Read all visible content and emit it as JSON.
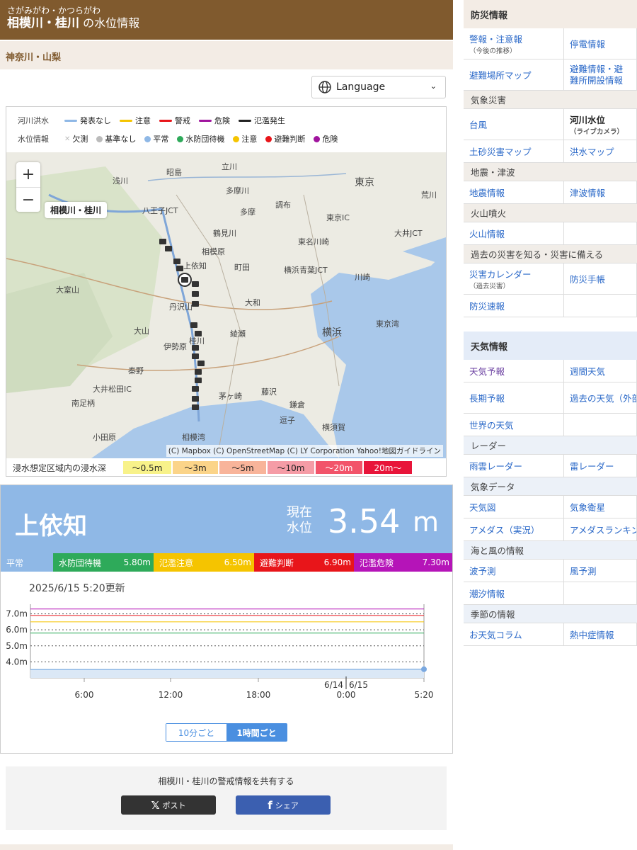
{
  "header": {
    "ruby": "さがみがわ・かつらがわ",
    "river": "相模川・桂川",
    "suffix": "の水位情報"
  },
  "region": "神奈川・山梨",
  "language": "Language",
  "legend": {
    "flood_label": "河川洪水",
    "flood_items": [
      {
        "label": "発表なし",
        "color": "#8fb8e6"
      },
      {
        "label": "注意",
        "color": "#f5c400"
      },
      {
        "label": "警戒",
        "color": "#e8151a"
      },
      {
        "label": "危険",
        "color": "#a0149e"
      },
      {
        "label": "氾濫発生",
        "color": "#222222"
      }
    ],
    "level_label": "水位情報",
    "level_items": [
      {
        "label": "欠測",
        "color": "#bbbbbb",
        "icon": "x-mark-icon"
      },
      {
        "label": "基準なし",
        "color": "#bbbbbb"
      },
      {
        "label": "平常",
        "color": "#8fb8e6"
      },
      {
        "label": "水防団待機",
        "color": "#2eaa5a"
      },
      {
        "label": "注意",
        "color": "#f5c400"
      },
      {
        "label": "避難判断",
        "color": "#e8151a"
      },
      {
        "label": "危険",
        "color": "#a0149e"
      }
    ]
  },
  "map": {
    "river_tag": "相模川・桂川",
    "attribution": "(C) Mapbox (C) OpenStreetMap (C) LY Corporation Yahoo!地図ガイドライン",
    "labels": [
      "浅川",
      "多摩川",
      "鶴見川",
      "東京",
      "荒川",
      "八王子JCT",
      "相模原",
      "町田",
      "東京IC",
      "東名川崎",
      "横浜青葉JCT",
      "大井JCT",
      "川崎",
      "大和",
      "横浜",
      "東京湾",
      "綾瀬",
      "伊勢原",
      "秦野",
      "大井松田IC",
      "南足柄",
      "小田原",
      "茅ヶ崎",
      "藤沢",
      "鎌倉",
      "逗子",
      "横須賀",
      "相模湾",
      "立川",
      "昭島",
      "調布",
      "多摩",
      "丹沢山",
      "大室山",
      "大山",
      "桂川",
      "上依知"
    ]
  },
  "depth": {
    "label": "浸水想定区域内の浸水深",
    "bins": [
      {
        "label": "〜0.5m",
        "color": "#f8f28a"
      },
      {
        "label": "〜3m",
        "color": "#fbd489"
      },
      {
        "label": "〜5m",
        "color": "#f8b49a"
      },
      {
        "label": "〜10m",
        "color": "#f59ca6"
      },
      {
        "label": "〜20m",
        "color": "#f2546a"
      },
      {
        "label": "20m〜",
        "color": "#e8153a"
      }
    ]
  },
  "station": {
    "name": "上依知",
    "current_label_1": "現在",
    "current_label_2": "水位",
    "value": "3.54",
    "unit": "m"
  },
  "thresholds": [
    {
      "label": "平常",
      "value": "",
      "color": "#8fb8e6"
    },
    {
      "label": "水防団待機",
      "value": "5.80m",
      "color": "#2eaa5a"
    },
    {
      "label": "氾濫注意",
      "value": "6.50m",
      "color": "#f5c400"
    },
    {
      "label": "避難判断",
      "value": "6.90m",
      "color": "#e8151a"
    },
    {
      "label": "氾濫危険",
      "value": "7.30m",
      "color": "#b514b8"
    }
  ],
  "updated": "2025/6/15 5:20更新",
  "chart_data": {
    "type": "line",
    "title": "",
    "xlabel": "",
    "ylabel": "",
    "x_ticks": [
      "6:00",
      "12:00",
      "18:00",
      "6/14 | 6/15 0:00",
      "5:20"
    ],
    "y_ticks": [
      "4.0m",
      "5.0m",
      "6.0m",
      "7.0m"
    ],
    "ylim": [
      3.0,
      7.6
    ],
    "threshold_lines": [
      {
        "name": "水防団待機",
        "value": 5.8,
        "color": "#2eaa5a"
      },
      {
        "name": "氾濫注意",
        "value": 6.5,
        "color": "#f5c400"
      },
      {
        "name": "避難判断",
        "value": 6.9,
        "color": "#e8151a"
      },
      {
        "name": "氾濫危険",
        "value": 7.3,
        "color": "#b514b8"
      }
    ],
    "series": [
      {
        "values_x": [
          0,
          0.25,
          0.5,
          0.75,
          1.0
        ],
        "values": [
          3.52,
          3.52,
          3.52,
          3.53,
          3.54
        ],
        "color": "#8fb8e6"
      }
    ]
  },
  "interval_tabs": [
    "10分ごと",
    "1時間ごと"
  ],
  "share": {
    "title": "相模川・桂川の警戒情報を共有する",
    "x_label": "ポスト",
    "fb_label": "シェア"
  },
  "sidebar": {
    "disaster_title": "防災情報",
    "disaster_rows": [
      {
        "type": "pair",
        "items": [
          {
            "label": "警報・注意報",
            "sub": "（今後の推移）"
          },
          {
            "label": "停電情報"
          }
        ]
      },
      {
        "type": "pair",
        "items": [
          {
            "label": "避難場所マップ"
          },
          {
            "label": "避難情報・避難所開設情報"
          }
        ]
      },
      {
        "type": "cat",
        "label": "気象災害"
      },
      {
        "type": "pair",
        "items": [
          {
            "label": "台風"
          },
          {
            "label": "河川水位",
            "sub": "（ライブカメラ）",
            "plain": true
          }
        ]
      },
      {
        "type": "pair",
        "items": [
          {
            "label": "土砂災害マップ"
          },
          {
            "label": "洪水マップ"
          }
        ]
      },
      {
        "type": "cat",
        "label": "地震・津波"
      },
      {
        "type": "pair",
        "items": [
          {
            "label": "地震情報"
          },
          {
            "label": "津波情報"
          }
        ]
      },
      {
        "type": "cat",
        "label": "火山噴火"
      },
      {
        "type": "pair",
        "items": [
          {
            "label": "火山情報"
          },
          {
            "label": ""
          }
        ]
      },
      {
        "type": "cat",
        "label": "過去の災害を知る・災害に備える"
      },
      {
        "type": "pair",
        "items": [
          {
            "label": "災害カレンダー",
            "sub": "（過去災害）"
          },
          {
            "label": "防災手帳"
          }
        ]
      },
      {
        "type": "pair",
        "items": [
          {
            "label": "防災速報"
          },
          {
            "label": ""
          }
        ]
      }
    ],
    "weather_title": "天気情報",
    "weather_rows": [
      {
        "type": "pair",
        "items": [
          {
            "label": "天気予報"
          },
          {
            "label": "週間天気"
          }
        ]
      },
      {
        "type": "pair",
        "items": [
          {
            "label": "長期予報"
          },
          {
            "label": "過去の天気（外部サイト）"
          }
        ]
      },
      {
        "type": "pair",
        "items": [
          {
            "label": "世界の天気"
          },
          {
            "label": ""
          }
        ]
      },
      {
        "type": "cat",
        "label": "レーダー"
      },
      {
        "type": "pair",
        "items": [
          {
            "label": "雨雲レーダー"
          },
          {
            "label": "雷レーダー"
          }
        ]
      },
      {
        "type": "cat",
        "label": "気象データ"
      },
      {
        "type": "pair",
        "items": [
          {
            "label": "天気図"
          },
          {
            "label": "気象衛星"
          }
        ]
      },
      {
        "type": "pair",
        "items": [
          {
            "label": "アメダス（実況）"
          },
          {
            "label": "アメダスランキング"
          }
        ]
      },
      {
        "type": "cat",
        "label": "海と風の情報"
      },
      {
        "type": "pair",
        "items": [
          {
            "label": "波予測"
          },
          {
            "label": "風予測"
          }
        ]
      },
      {
        "type": "pair",
        "items": [
          {
            "label": "潮汐情報"
          },
          {
            "label": ""
          }
        ]
      },
      {
        "type": "cat",
        "label": "季節の情報"
      },
      {
        "type": "pair",
        "items": [
          {
            "label": "お天気コラム"
          },
          {
            "label": "熱中症情報"
          }
        ]
      }
    ]
  }
}
